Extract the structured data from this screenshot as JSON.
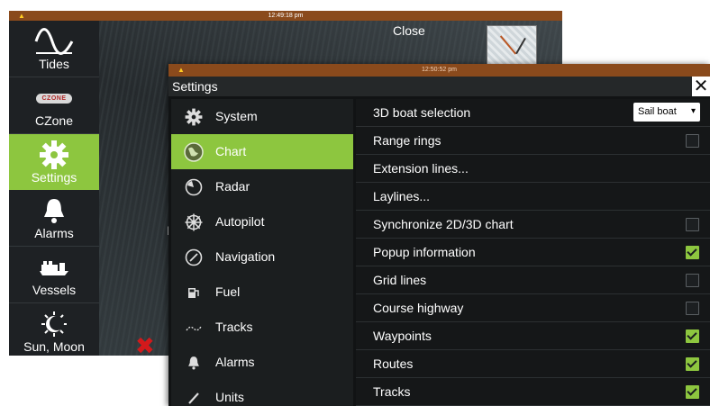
{
  "background_window": {
    "clock": "12:49:18 pm",
    "close_label": "Close",
    "partial_text": "I"
  },
  "left_nav": {
    "items": [
      {
        "label": "Tides",
        "icon": "sine-wave-icon"
      },
      {
        "label": "CZone",
        "icon": "czone-logo-icon",
        "logo_text": "CZONE"
      },
      {
        "label": "Settings",
        "icon": "gear-icon",
        "active": true
      },
      {
        "label": "Alarms",
        "icon": "bell-icon"
      },
      {
        "label": "Vessels",
        "icon": "vessels-icon"
      },
      {
        "label": "Sun, Moon",
        "icon": "moon-icon"
      }
    ]
  },
  "settings": {
    "clock": "12:50:52 pm",
    "title": "Settings",
    "close_symbol": "✕",
    "categories": [
      {
        "label": "System",
        "icon": "gear-icon"
      },
      {
        "label": "Chart",
        "icon": "globe-icon",
        "active": true
      },
      {
        "label": "Radar",
        "icon": "radar-icon"
      },
      {
        "label": "Autopilot",
        "icon": "helm-icon"
      },
      {
        "label": "Navigation",
        "icon": "compass-icon"
      },
      {
        "label": "Fuel",
        "icon": "fuel-pump-icon"
      },
      {
        "label": "Tracks",
        "icon": "track-icon"
      },
      {
        "label": "Alarms",
        "icon": "bell-icon"
      },
      {
        "label": "Units",
        "icon": "ruler-icon"
      }
    ],
    "options": [
      {
        "label": "3D boat selection",
        "control": "select",
        "value": "Sail boat"
      },
      {
        "label": "Range rings",
        "control": "checkbox",
        "checked": false
      },
      {
        "label": "Extension lines...",
        "control": "none"
      },
      {
        "label": "Laylines...",
        "control": "none"
      },
      {
        "label": "Synchronize 2D/3D chart",
        "control": "checkbox",
        "checked": false
      },
      {
        "label": "Popup information",
        "control": "checkbox",
        "checked": true
      },
      {
        "label": "Grid lines",
        "control": "checkbox",
        "checked": false
      },
      {
        "label": "Course highway",
        "control": "checkbox",
        "checked": false
      },
      {
        "label": "Waypoints",
        "control": "checkbox",
        "checked": true
      },
      {
        "label": "Routes",
        "control": "checkbox",
        "checked": true
      },
      {
        "label": "Tracks",
        "control": "checkbox",
        "checked": true
      }
    ]
  },
  "colors": {
    "accent": "#8dc63f",
    "status_bar": "#8a4a1c",
    "panel_dark": "#1b1e1f",
    "error_x": "#d3191b"
  }
}
